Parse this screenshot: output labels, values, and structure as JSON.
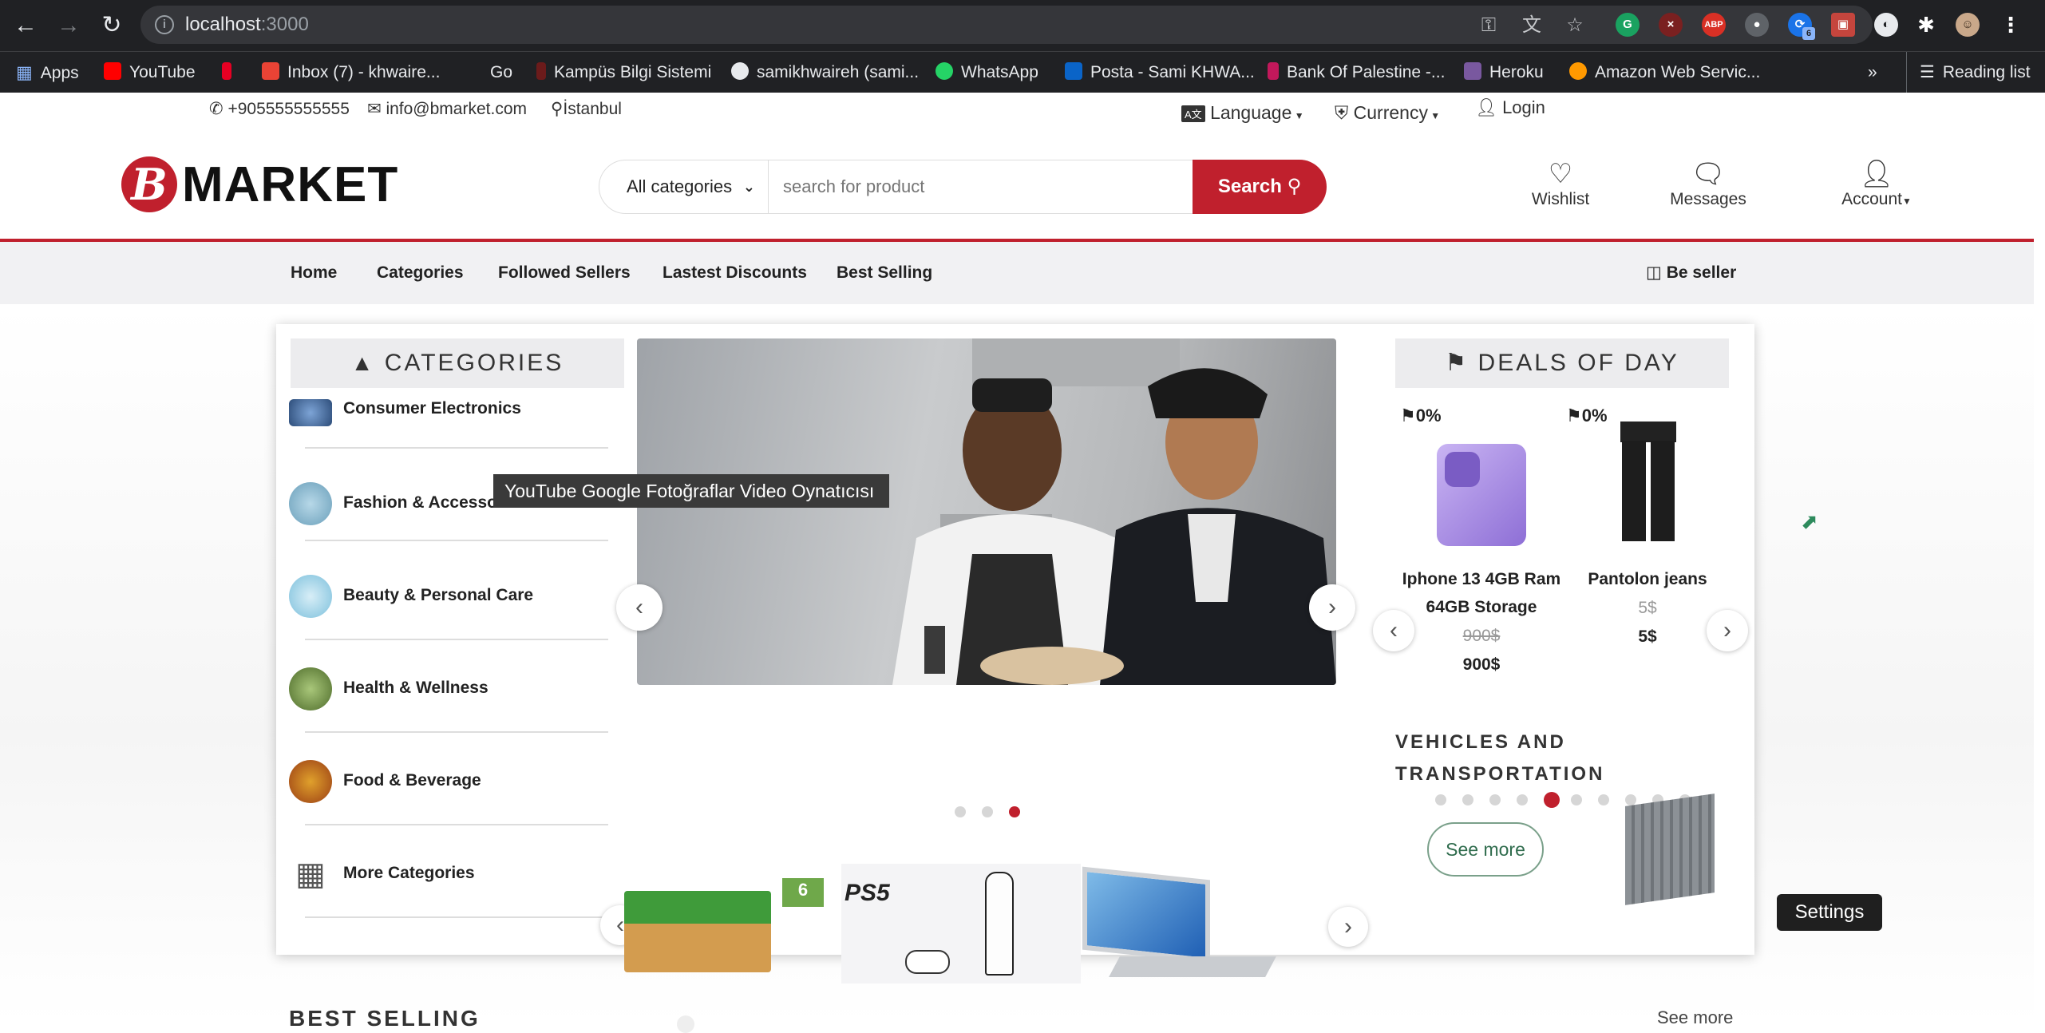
{
  "browser": {
    "url_host": "localhost",
    "url_port": ":3000",
    "bookmarks": [
      "Apps",
      "YouTube",
      "Inbox (7) - khwaire...",
      "Go",
      "Kampüs Bilgi Sistemi",
      "samikhwaireh (sami...",
      "WhatsApp",
      "Posta - Sami KHWA...",
      "Bank Of Palestine -...",
      "Heroku",
      "Amazon Web Servic...",
      "»",
      "Reading list"
    ],
    "extension_badge": "6"
  },
  "topbar": {
    "phone": "+905555555555",
    "email": "info@bmarket.com",
    "location": "İstanbul",
    "language": "Language",
    "currency": "Currency",
    "login": "Login"
  },
  "header": {
    "logo_letter": "B",
    "logo_text": "MARKET",
    "category_select": "All categories",
    "search_placeholder": "search for product",
    "search_button": "Search",
    "wishlist": "Wishlist",
    "messages": "Messages",
    "account": "Account"
  },
  "nav": {
    "items": [
      "Home",
      "Categories",
      "Followed Sellers",
      "Lastest Discounts",
      "Best Selling"
    ],
    "be_seller": "Be seller"
  },
  "categories": {
    "title": "CATEGORIES",
    "items": [
      "Consumer Electronics",
      "Fashion & Accessories",
      "Beauty & Personal Care",
      "Health & Wellness",
      "Food & Beverage",
      "More Categories"
    ]
  },
  "hero": {
    "dots": 3,
    "active_dot": 3
  },
  "strip": {
    "badge": "6",
    "ps5_label": "PS5"
  },
  "deals": {
    "title": "DEALS OF DAY",
    "products": [
      {
        "discount": "0%",
        "name_line1": "Iphone 13 4GB Ram",
        "name_line2": "64GB Storage",
        "old_price": "900$",
        "price": "900$"
      },
      {
        "discount": "0%",
        "name_line1": "Pantolon jeans",
        "name_line2": "",
        "old_price": "5$",
        "price": "5$"
      }
    ],
    "dots": 10,
    "active_dot": 5
  },
  "vehicles": {
    "title_line1": "VEHICLES AND",
    "title_line2": "TRANSPORTATION",
    "see_more": "See more"
  },
  "best_selling": {
    "title": "BEST SELLING",
    "see_more": "See more"
  },
  "overlay": {
    "tooltip": "YouTube Google Fotoğraflar Video Oynatıcısı",
    "settings": "Settings"
  },
  "colors": {
    "brand": "#c0202d",
    "chrome_bg": "#202124"
  }
}
